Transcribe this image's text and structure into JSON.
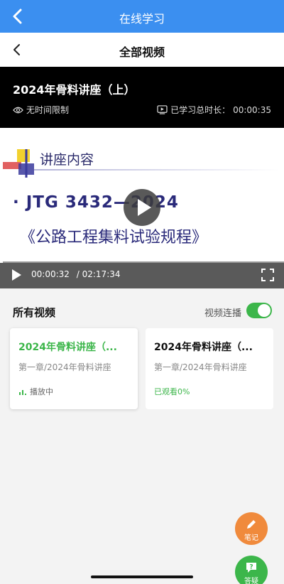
{
  "app": {
    "title": "在线学习"
  },
  "navbar": {
    "title": "全部视频"
  },
  "video_info": {
    "title": "2024年骨料讲座（上）",
    "limit": "无时间限制",
    "total_label": "已学习总时长：",
    "total_value": "00:00:35"
  },
  "slide": {
    "heading": "讲座内容",
    "standard": "· JTG 3432—2024",
    "book": "《公路工程集料试验规程》"
  },
  "player": {
    "current_time": "00:00:32",
    "separator": "/",
    "duration": "02:17:34",
    "progress_fraction": 0.0039
  },
  "playlist": {
    "heading": "所有视频",
    "autoplay_label": "视频连播",
    "autoplay_on": true,
    "items": [
      {
        "title": "2024年骨料讲座（...",
        "subtitle": "第一章/2024年骨料讲座",
        "status": "播放中",
        "active": true
      },
      {
        "title": "2024年骨料讲座（...",
        "subtitle": "第一章/2024年骨料讲座",
        "status": "已观看0%",
        "active": false
      }
    ]
  },
  "fabs": {
    "note_label": "笔记",
    "qa_label": "答疑"
  },
  "colors": {
    "topbar": "#3b8ff0",
    "accent_green": "#3cb64a",
    "note_orange": "#f08a3c"
  }
}
